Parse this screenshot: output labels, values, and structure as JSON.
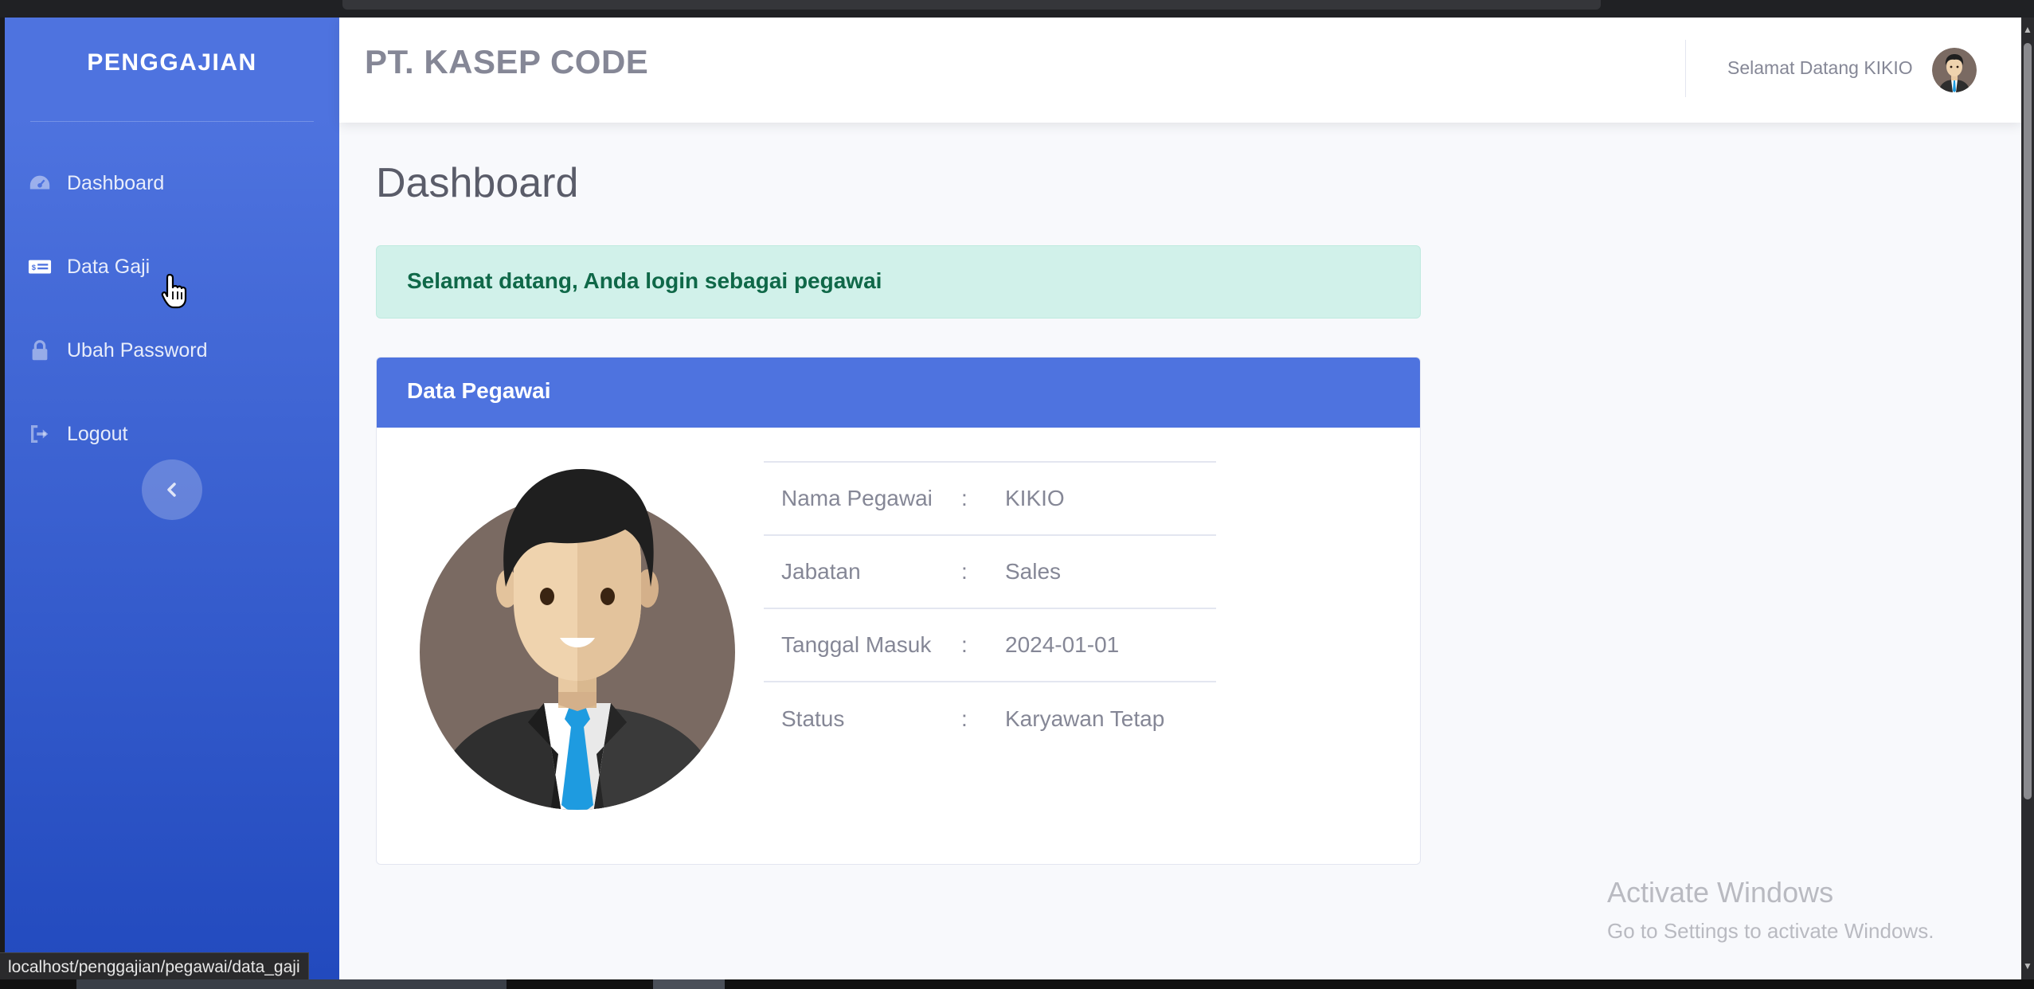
{
  "sidebar": {
    "brand": "PENGGAJIAN",
    "items": [
      {
        "label": "Dashboard",
        "icon": "dashboard-icon"
      },
      {
        "label": "Data Gaji",
        "icon": "money-bill-icon"
      },
      {
        "label": "Ubah Password",
        "icon": "lock-icon"
      },
      {
        "label": "Logout",
        "icon": "sign-out-icon"
      }
    ],
    "toggle_icon": "chevron-left-icon"
  },
  "topbar": {
    "company": "PT. KASEP CODE",
    "greeting": "Selamat Datang KIKIO"
  },
  "main": {
    "title": "Dashboard",
    "alert": "Selamat datang, Anda login sebagai pegawai",
    "card": {
      "title": "Data Pegawai",
      "rows": [
        {
          "label": "Nama Pegawai",
          "sep": ":",
          "value": "KIKIO"
        },
        {
          "label": "Jabatan",
          "sep": ":",
          "value": "Sales"
        },
        {
          "label": "Tanggal Masuk",
          "sep": ":",
          "value": "2024-01-01"
        },
        {
          "label": "Status",
          "sep": ":",
          "value": "Karyawan Tetap"
        }
      ]
    }
  },
  "watermark": {
    "line1": "Activate Windows",
    "line2": "Go to Settings to activate Windows."
  },
  "status_url": "localhost/penggajian/pegawai/data_gaji",
  "colors": {
    "primary": "#4e73df",
    "sidebar_gradient_end": "#224abe",
    "alert_bg": "#d1f1ea",
    "alert_text": "#0f6848",
    "muted_text": "#858796"
  }
}
